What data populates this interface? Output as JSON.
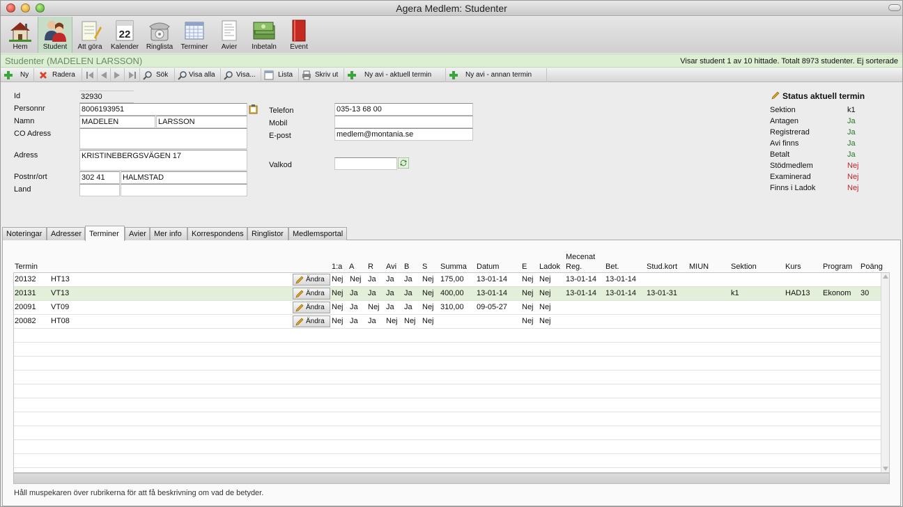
{
  "window": {
    "title": "Agera Medlem: Studenter"
  },
  "main_toolbar": [
    {
      "label": "Hem",
      "icon": "house-icon"
    },
    {
      "label": "Student",
      "icon": "student-icon",
      "active": true
    },
    {
      "label": "Att göra",
      "icon": "notepad-icon"
    },
    {
      "label": "Kalender",
      "icon": "calendar-icon",
      "day": "22"
    },
    {
      "label": "Ringlista",
      "icon": "phone-icon"
    },
    {
      "label": "Terminer",
      "icon": "grid-calendar-icon"
    },
    {
      "label": "Avier",
      "icon": "invoice-icon"
    },
    {
      "label": "Inbetaln",
      "icon": "money-icon"
    },
    {
      "label": "Event",
      "icon": "book-icon"
    }
  ],
  "header": {
    "title": "Studenter (MADELEN LARSSON)",
    "status": "Visar student 1 av 10 hittade. Totalt 8973 studenter. Ej sorterade"
  },
  "action_toolbar": {
    "new": "Ny",
    "delete": "Radera",
    "search": "Sök",
    "show_all": "Visa alla",
    "show": "Visa...",
    "list": "Lista",
    "print": "Skriv ut",
    "new_invoice_current": "Ny avi - aktuell termin",
    "new_invoice_other": "Ny avi - annan termin"
  },
  "form": {
    "id_label": "Id",
    "id": "32930",
    "personnr_label": "Personnr",
    "personnr": "8006193951",
    "name_label": "Namn",
    "first_name": "MADELEN",
    "last_name": "LARSSON",
    "co_label": "CO Adress",
    "co": "",
    "address_label": "Adress",
    "address": "KRISTINEBERGSVÄGEN 17",
    "postort_label": "Postnr/ort",
    "postnr": "302 41",
    "ort": "HALMSTAD",
    "land_label": "Land",
    "land_code": "",
    "land": "",
    "phone_label": "Telefon",
    "phone": "035-13 68 00",
    "mobile_label": "Mobil",
    "mobile": "",
    "email_label": "E-post",
    "email": "medlem@montania.se",
    "valkod_label": "Valkod",
    "valkod": ""
  },
  "status": {
    "title": "Status aktuell termin",
    "rows": [
      {
        "label": "Sektion",
        "value": "k1",
        "color": "#111111"
      },
      {
        "label": "Antagen",
        "value": "Ja",
        "color": "#1d7a1d"
      },
      {
        "label": "Registrerad",
        "value": "Ja",
        "color": "#1d7a1d"
      },
      {
        "label": "Avi finns",
        "value": "Ja",
        "color": "#1d7a1d"
      },
      {
        "label": "Betalt",
        "value": "Ja",
        "color": "#1d7a1d"
      },
      {
        "label": "Stödmedlem",
        "value": "Nej",
        "color": "#c0252b"
      },
      {
        "label": "Examinerad",
        "value": "Nej",
        "color": "#c0252b"
      },
      {
        "label": "Finns i Ladok",
        "value": "Nej",
        "color": "#c0252b"
      }
    ]
  },
  "tabs": [
    "Noteringar",
    "Adresser",
    "Terminer",
    "Avier",
    "Mer info",
    "Korrespondens",
    "Ringlistor",
    "Medlemsportal"
  ],
  "active_tab": "Terminer",
  "table": {
    "headers": {
      "termin": "Termin",
      "first": "1:a",
      "a": "A",
      "r": "R",
      "avi": "Avi",
      "b": "B",
      "s": "S",
      "summa": "Summa",
      "datum": "Datum",
      "e": "E",
      "ladok": "Ladok",
      "mecenat": "Mecenat",
      "reg": "Reg.",
      "bet": "Bet.",
      "studkort": "Stud.kort",
      "miun": "MIUN",
      "sektion": "Sektion",
      "kurs": "Kurs",
      "program": "Program",
      "poang": "Poäng"
    },
    "edit_label": "Ändra",
    "rows": [
      {
        "termin": "20132",
        "name": "HT13",
        "first": "Nej",
        "a": "Nej",
        "r": "Ja",
        "avi": "Ja",
        "b": "Ja",
        "s": "Nej",
        "summa": "175,00",
        "datum": "13-01-14",
        "e": "Nej",
        "ladok": "Nej",
        "reg": "13-01-14",
        "bet": "13-01-14",
        "studkort": "",
        "miun": "",
        "sektion": "",
        "kurs": "",
        "program": "",
        "poang": ""
      },
      {
        "termin": "20131",
        "name": "VT13",
        "first": "Nej",
        "a": "Ja",
        "r": "Ja",
        "avi": "Ja",
        "b": "Ja",
        "s": "Nej",
        "summa": "400,00",
        "datum": "13-01-14",
        "e": "Nej",
        "ladok": "Nej",
        "reg": "13-01-14",
        "bet": "13-01-14",
        "studkort": "13-01-31",
        "miun": "",
        "sektion": "k1",
        "kurs": "HAD13",
        "program": "Ekonom",
        "poang": "30",
        "selected": true
      },
      {
        "termin": "20091",
        "name": "VT09",
        "first": "Nej",
        "a": "Ja",
        "r": "Nej",
        "avi": "Ja",
        "b": "Ja",
        "s": "Nej",
        "summa": "310,00",
        "datum": "09-05-27",
        "e": "Nej",
        "ladok": "Nej",
        "reg": "",
        "bet": "",
        "studkort": "",
        "miun": "",
        "sektion": "",
        "kurs": "",
        "program": "",
        "poang": ""
      },
      {
        "termin": "20082",
        "name": "HT08",
        "first": "Nej",
        "a": "Ja",
        "r": "Ja",
        "avi": "Nej",
        "b": "Nej",
        "s": "Nej",
        "summa": "",
        "datum": "",
        "e": "Nej",
        "ladok": "Nej",
        "reg": "",
        "bet": "",
        "studkort": "",
        "miun": "",
        "sektion": "",
        "kurs": "",
        "program": "",
        "poang": ""
      }
    ]
  },
  "hint": "Håll muspekaren över rubrikerna för att få beskrivning om vad de betyder."
}
